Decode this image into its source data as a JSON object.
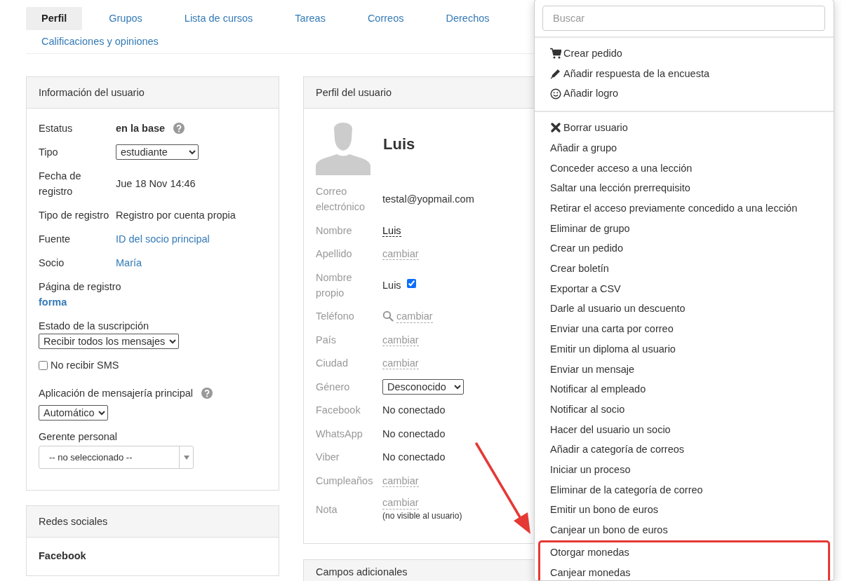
{
  "tabs": [
    {
      "label": "Perfil",
      "selected": true
    },
    {
      "label": "Grupos",
      "selected": false
    },
    {
      "label": "Lista de cursos",
      "selected": false
    },
    {
      "label": "Tareas",
      "selected": false
    },
    {
      "label": "Correos",
      "selected": false
    },
    {
      "label": "Derechos",
      "selected": false
    },
    {
      "label": "Calificaciones y opiniones",
      "selected": false
    }
  ],
  "user_info": {
    "title": "Información del usuario",
    "fields": [
      {
        "kind": "bold",
        "label": "Estatus",
        "value": "en la base",
        "help": true
      },
      {
        "kind": "select",
        "label": "Tipo",
        "value": "estudiante",
        "help": false
      },
      {
        "kind": "text",
        "label": "Fecha de registro",
        "value": "Jue 18 Nov 14:46",
        "help": false
      },
      {
        "kind": "text",
        "label": "Tipo de registro",
        "value": "Registro por cuenta propia",
        "help": false
      },
      {
        "kind": "link",
        "label": "Fuente",
        "value": "ID del socio principal",
        "help": false
      },
      {
        "kind": "link",
        "label": "Socio",
        "value": "María",
        "help": false
      }
    ],
    "stacked": [
      {
        "kind": "link",
        "label": "Página de registro",
        "value": "forma",
        "help": false
      },
      {
        "kind": "select",
        "label": "Estado de la suscripción",
        "value": "Recibir todos los mensajes",
        "help": false
      },
      {
        "kind": "checkbox",
        "label": "No recibir SMS",
        "checked": false
      },
      {
        "kind": "select",
        "label": "Aplicación de mensajería principal",
        "value": "Automático",
        "help": true
      },
      {
        "kind": "combo",
        "label": "Gerente personal",
        "value": "-- no seleccionado --",
        "help": false
      }
    ]
  },
  "social": {
    "title": "Redes sociales",
    "items": [
      "Facebook"
    ]
  },
  "profile": {
    "title": "Perfil del usuario",
    "name": "Luis",
    "fields": [
      {
        "kind": "text",
        "label": "Correo electrónico",
        "value": "testal@yopmail.com"
      },
      {
        "kind": "edit",
        "label": "Nombre",
        "value": "Luis"
      },
      {
        "kind": "change",
        "label": "Apellido",
        "value": "cambiar"
      },
      {
        "kind": "check",
        "label": "Nombre propio",
        "value": "Luis",
        "checked": true
      },
      {
        "kind": "search-change",
        "label": "Teléfono",
        "value": "cambiar"
      },
      {
        "kind": "change",
        "label": "País",
        "value": "cambiar"
      },
      {
        "kind": "change",
        "label": "Ciudad",
        "value": "cambiar"
      },
      {
        "kind": "select",
        "label": "Género",
        "value": "Desconocido"
      },
      {
        "kind": "text",
        "label": "Facebook",
        "value": "No conectado"
      },
      {
        "kind": "text",
        "label": "WhatsApp",
        "value": "No conectado"
      },
      {
        "kind": "text",
        "label": "Viber",
        "value": "No conectado"
      },
      {
        "kind": "change",
        "label": "Cumpleaños",
        "value": "cambiar"
      },
      {
        "kind": "change",
        "label": "Nota",
        "value": "cambiar",
        "note": "(no visible al usuario)"
      }
    ]
  },
  "extra": {
    "title": "Campos adicionales"
  },
  "menu": {
    "placeholder": "Buscar",
    "groups": [
      [
        {
          "label": "Crear pedido",
          "kind": "cart",
          "highlighted": false
        },
        {
          "label": "Añadir respuesta de la encuesta",
          "kind": "pencil",
          "highlighted": false
        },
        {
          "label": "Añadir logro",
          "kind": "smiley",
          "highlighted": false
        }
      ],
      [
        {
          "label": "Borrar usuario",
          "kind": "cross",
          "highlighted": false
        },
        {
          "label": "Añadir a grupo",
          "highlighted": false
        },
        {
          "label": "Conceder acceso a una lección",
          "highlighted": false
        },
        {
          "label": "Saltar una lección prerrequisito",
          "highlighted": false
        },
        {
          "label": "Retirar el acceso previamente concedido a una lección",
          "highlighted": false
        },
        {
          "label": "Eliminar de grupo",
          "highlighted": false
        },
        {
          "label": "Crear un pedido",
          "highlighted": false
        },
        {
          "label": "Crear boletín",
          "highlighted": false
        },
        {
          "label": "Exportar a CSV",
          "highlighted": false
        },
        {
          "label": "Darle al usuario un descuento",
          "highlighted": false
        },
        {
          "label": "Enviar una carta por correo",
          "highlighted": false
        },
        {
          "label": "Emitir un diploma al usuario",
          "highlighted": false
        },
        {
          "label": "Enviar un mensaje",
          "highlighted": false
        },
        {
          "label": "Notificar al empleado",
          "highlighted": false
        },
        {
          "label": "Notificar al socio",
          "highlighted": false
        },
        {
          "label": "Hacer del usuario un socio",
          "highlighted": false
        },
        {
          "label": "Añadir a categoría de correos",
          "highlighted": false
        },
        {
          "label": "Iniciar un proceso",
          "highlighted": false
        },
        {
          "label": "Eliminar de la categoría de correo",
          "highlighted": false
        },
        {
          "label": "Emitir un bono de euros",
          "highlighted": false
        },
        {
          "label": "Canjear un bono de euros",
          "highlighted": false
        },
        {
          "label": "Otorgar monedas",
          "highlighted": true
        },
        {
          "label": "Canjear monedas",
          "highlighted": true
        }
      ]
    ]
  }
}
